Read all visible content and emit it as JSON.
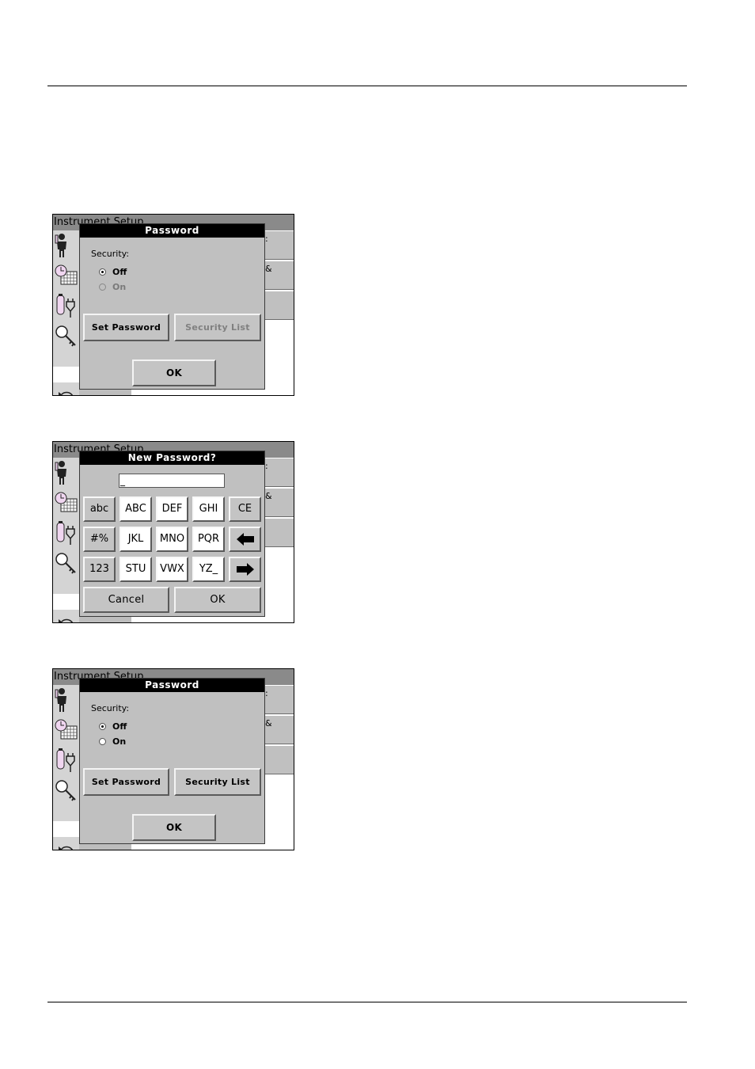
{
  "screens": [
    {
      "window_title": "Instrument Setup",
      "right_buttons": [
        ":",
        "&",
        ""
      ],
      "dialog": {
        "title": "Password",
        "security_label": "Security:",
        "options": [
          {
            "label": "Off",
            "selected": true,
            "enabled": true
          },
          {
            "label": "On",
            "selected": false,
            "enabled": false
          }
        ],
        "set_password_label": "Set Password",
        "security_list_label": "Security List",
        "security_list_enabled": false,
        "ok_label": "OK"
      }
    },
    {
      "window_title": "Instrument Setup",
      "right_buttons": [
        ":",
        "&",
        ""
      ],
      "dialog": {
        "title": "New Password?",
        "input_value": "_",
        "keys": [
          [
            "abc",
            "ABC",
            "DEF",
            "GHI",
            "CE"
          ],
          [
            "#%",
            "JKL",
            "MNO",
            "PQR",
            "backspace-arrow-icon"
          ],
          [
            "123",
            "STU",
            "VWX",
            "YZ_",
            "forward-arrow-icon"
          ]
        ],
        "cancel_label": "Cancel",
        "ok_label": "OK"
      }
    },
    {
      "window_title": "Instrument Setup",
      "right_buttons": [
        ":",
        "&",
        ""
      ],
      "dialog": {
        "title": "Password",
        "security_label": "Security:",
        "options": [
          {
            "label": "Off",
            "selected": true,
            "enabled": true
          },
          {
            "label": "On",
            "selected": false,
            "enabled": true
          }
        ],
        "set_password_label": "Set Password",
        "security_list_label": "Security List",
        "security_list_enabled": true,
        "ok_label": "OK"
      }
    }
  ]
}
